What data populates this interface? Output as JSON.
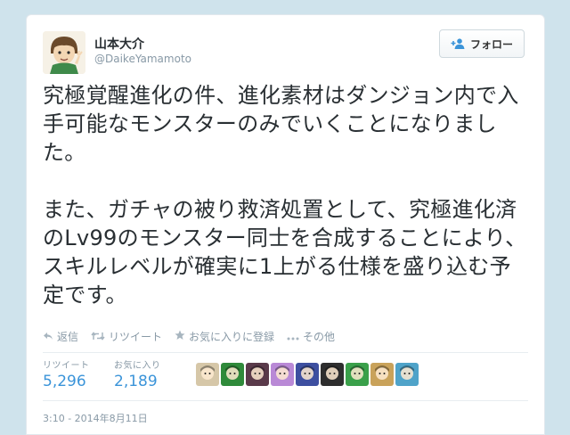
{
  "user": {
    "display_name": "山本大介",
    "handle": "@DaikeYamamoto"
  },
  "follow_button": {
    "label": "フォロー",
    "icon": "add-user-icon"
  },
  "tweet": {
    "text": "究極覚醒進化の件、進化素材はダンジョン内で入手可能なモンスターのみでいくことになりました。\n\nまた、ガチャの被り救済処置として、究極進化済のLv99のモンスター同士を合成することにより、スキルレベルが確実に1上がる仕様を盛り込む予定です。"
  },
  "actions": [
    {
      "icon": "reply-icon",
      "label": "返信"
    },
    {
      "icon": "retweet-icon",
      "label": "リツイート"
    },
    {
      "icon": "star-icon",
      "label": "お気に入りに登録"
    },
    {
      "icon": "more-icon",
      "label": "その他"
    }
  ],
  "stats": {
    "retweets": {
      "label": "リツイート",
      "value": "5,296"
    },
    "favorites": {
      "label": "お気に入り",
      "value": "2,189"
    }
  },
  "favoriters": [
    {
      "color": "#d6c7a8"
    },
    {
      "color": "#2f8a3a"
    },
    {
      "color": "#5a3a4a"
    },
    {
      "color": "#b989d6"
    },
    {
      "color": "#3d4fa0"
    },
    {
      "color": "#2e2e2e"
    },
    {
      "color": "#3aa04a"
    },
    {
      "color": "#c9a25a"
    },
    {
      "color": "#4fa3c9"
    }
  ],
  "timestamp": "3:10 - 2014年8月11日",
  "colors": {
    "link": "#3b94d9",
    "muted": "#8899a6",
    "text": "#292f33"
  }
}
